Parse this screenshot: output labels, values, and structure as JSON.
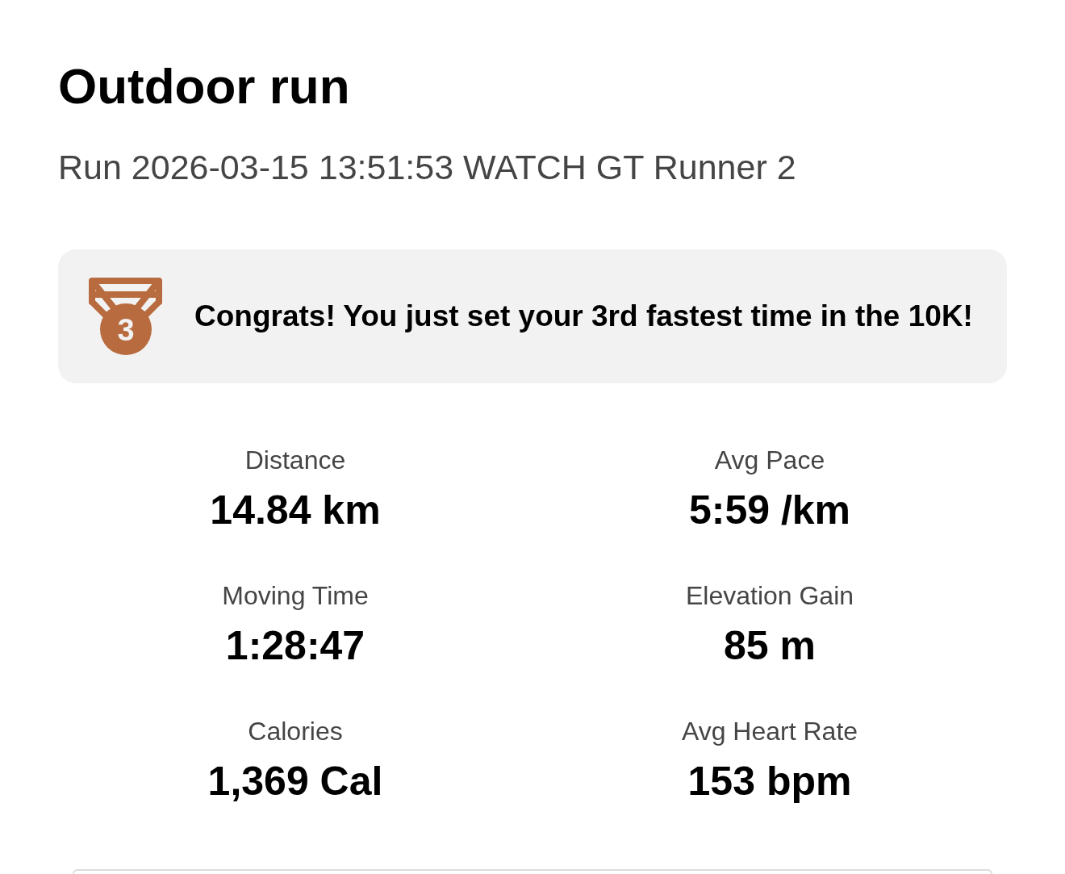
{
  "title": "Outdoor run",
  "subtitle": "Run 2026-03-15 13:51:53 WATCH GT Runner 2",
  "achievement": {
    "medal": "3",
    "message": "Congrats! You just set your 3rd fastest time in the 10K!"
  },
  "stats": [
    {
      "label": "Distance",
      "value": "14.84 km"
    },
    {
      "label": "Avg Pace",
      "value": "5:59 /km"
    },
    {
      "label": "Moving Time",
      "value": "1:28:47"
    },
    {
      "label": "Elevation Gain",
      "value": "85 m"
    },
    {
      "label": "Calories",
      "value": "1,369 Cal"
    },
    {
      "label": "Avg Heart Rate",
      "value": "153 bpm"
    }
  ]
}
